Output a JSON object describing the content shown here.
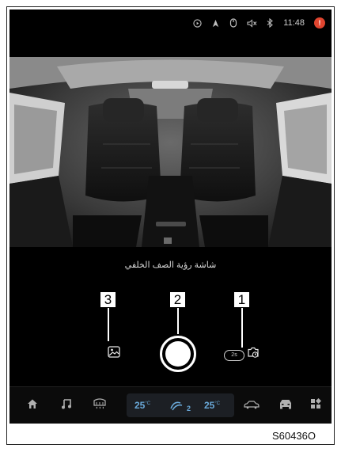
{
  "status_bar": {
    "time": "11:48",
    "icons": [
      "media-play-icon",
      "navigation-icon",
      "mouse-icon",
      "volume-mute-icon",
      "bluetooth-icon",
      "warning-icon"
    ]
  },
  "camera": {
    "caption": "شاشة رؤية الصف الخلفي"
  },
  "callouts": {
    "c1": "1",
    "c2": "2",
    "c3": "3"
  },
  "controls": {
    "timer_label": "2s"
  },
  "climate": {
    "left_temp": "25",
    "right_temp": "25",
    "unit": "°C",
    "fan_level": "2"
  },
  "figure_code": "S60436O",
  "colors": {
    "accent": "#69a8d8",
    "warning": "#e0452f"
  }
}
